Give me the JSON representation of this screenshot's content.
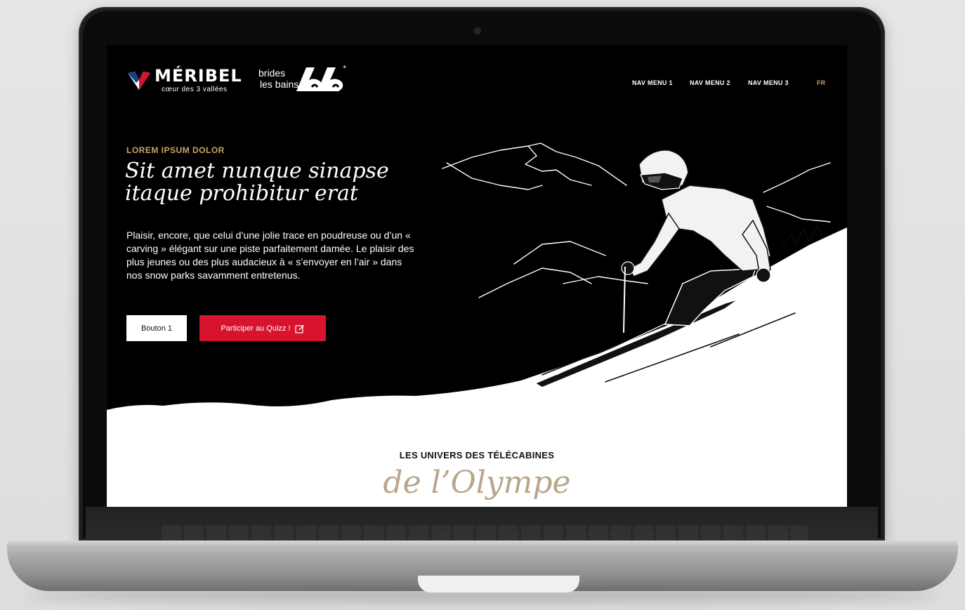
{
  "brand": {
    "primary_logo": "MÉRIBEL",
    "primary_tagline": "cœur des 3 vallées",
    "secondary_logo_line1": "brides",
    "secondary_logo_line2": "les bains"
  },
  "nav": {
    "items": [
      "NAV MENU 1",
      "NAV MENU 2",
      "NAV MENU 3"
    ],
    "language": "FR"
  },
  "hero": {
    "eyebrow": "LOREM IPSUM DOLOR",
    "headline": "Sit amet nunque sinapse itaque prohibitur erat",
    "body": "Plaisir, encore, que celui d’une jolie trace en poudreuse ou d’un « carving » élégant sur une piste parfaitement damée. Le plaisir des plus jeunes ou des plus audacieux à « s’envoyer en l’air » dans nos snow parks savamment entretenus.",
    "button_primary": "Bouton 1",
    "button_quiz": "Participer au Quizz !"
  },
  "section": {
    "subtitle": "LES UNIVERS DES TÉLÉCABINES",
    "script_title": "de l’Olympe"
  },
  "colors": {
    "accent_gold": "#c9a46a",
    "accent_red": "#d7132e",
    "script_beige": "#b8a58a",
    "background_dark": "#000000"
  },
  "icons": {
    "quiz": "edit-icon",
    "logo_heart": "heart-flag-icon"
  }
}
